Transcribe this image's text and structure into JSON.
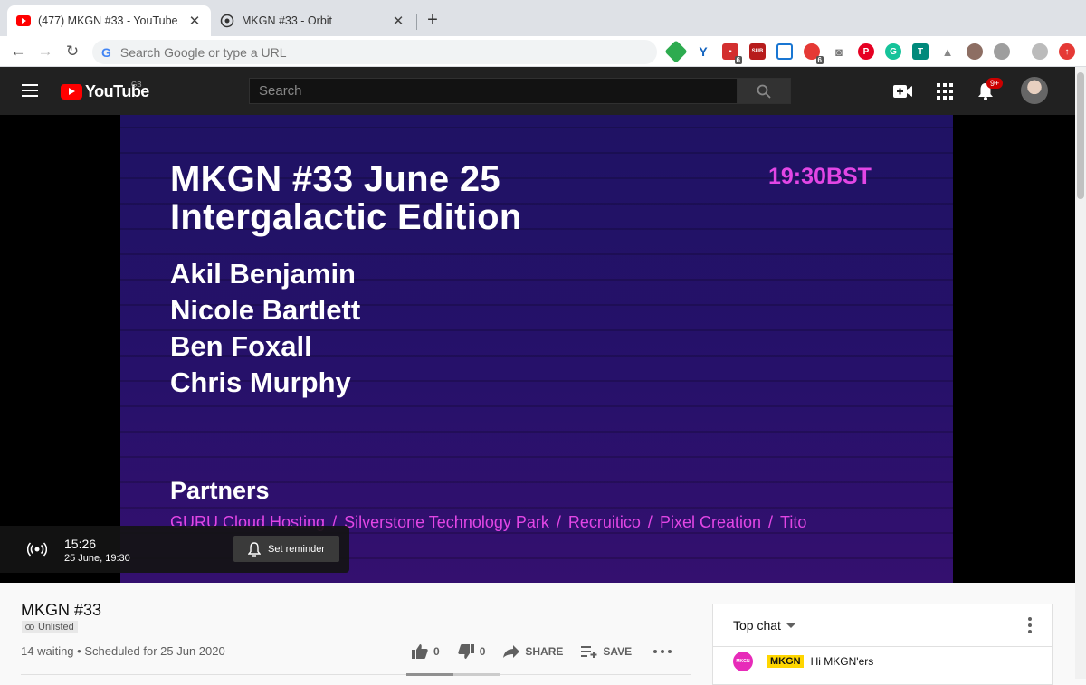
{
  "browser": {
    "tabs": [
      {
        "title": "(477) MKGN #33 - YouTube",
        "active": true
      },
      {
        "title": "MKGN #33 - Orbit",
        "active": false
      }
    ],
    "omnibox_placeholder": "Search Google or type a URL",
    "extension_badges": [
      "6",
      "6"
    ]
  },
  "youtube": {
    "logo_text": "YouTube",
    "country": "GB",
    "search_placeholder": "Search",
    "notification_count": "9+"
  },
  "slide": {
    "title_line1": "MKGN #33 June 25",
    "title_line2": "Intergalactic Edition",
    "time": "19:30BST",
    "speakers": [
      "Akil Benjamin",
      "Nicole Bartlett",
      "Ben Foxall",
      "Chris Murphy"
    ],
    "partners_heading": "Partners",
    "partners": [
      "GURU Cloud Hosting",
      "Silverstone Technology Park",
      "Recruitico",
      "Pixel Creation",
      "Tito"
    ]
  },
  "premiere": {
    "countdown": "15:26",
    "date": "25 June, 19:30",
    "reminder_label": "Set reminder"
  },
  "video": {
    "title": "MKGN #33",
    "visibility": "Unlisted",
    "waiting": "14 waiting",
    "scheduled": "Scheduled for 25 Jun 2020",
    "likes": "0",
    "dislikes": "0",
    "share_label": "SHARE",
    "save_label": "SAVE"
  },
  "chat": {
    "mode": "Top chat",
    "messages": [
      {
        "author": "MKGN",
        "avatar_text": "MKGN",
        "text": "Hi MKGN'ers"
      }
    ]
  },
  "colors": {
    "accent_pink": "#e246e5",
    "slide_bg": "#26116a",
    "youtube_red": "#ff0000",
    "masthead": "#212121"
  }
}
